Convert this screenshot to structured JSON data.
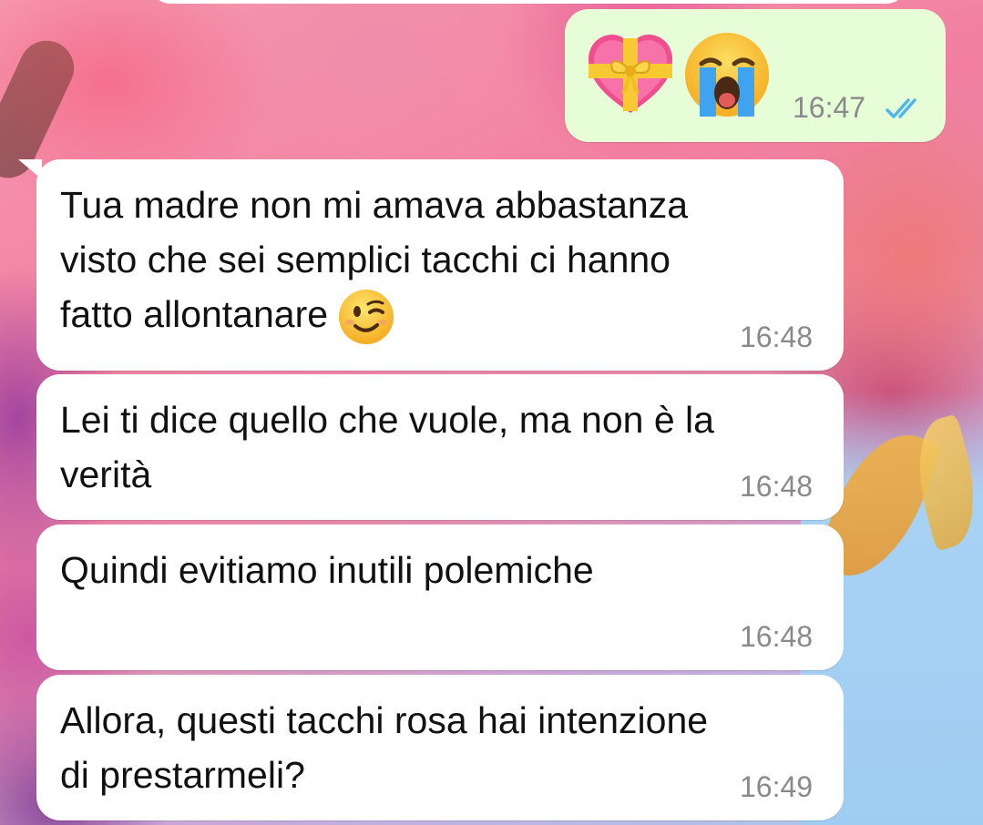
{
  "chat": {
    "messages": [
      {
        "direction": "outgoing",
        "emojis": [
          "heart-with-ribbon",
          "loudly-crying-face"
        ],
        "time": "16:47",
        "status": "read"
      },
      {
        "direction": "incoming",
        "text": "Tua madre non mi amava abbastanza\nvisto che sei semplici tacchi ci hanno\nfatto allontanare",
        "emoji": "winking-face",
        "time": "16:48"
      },
      {
        "direction": "incoming",
        "text": "Lei ti dice quello che vuole, ma non è la\nverità",
        "time": "16:48"
      },
      {
        "direction": "incoming",
        "text": "Quindi evitiamo inutili polemiche",
        "time": "16:48"
      },
      {
        "direction": "incoming",
        "text": "Allora, questi tacchi rosa hai intenzione\ndi prestarmeli?",
        "time": "16:49"
      }
    ]
  },
  "colors": {
    "incoming_bubble": "#ffffff",
    "outgoing_bubble": "#e7fdd8",
    "timestamp": "#8a8a8a",
    "read_ticks": "#4fb6ec"
  }
}
